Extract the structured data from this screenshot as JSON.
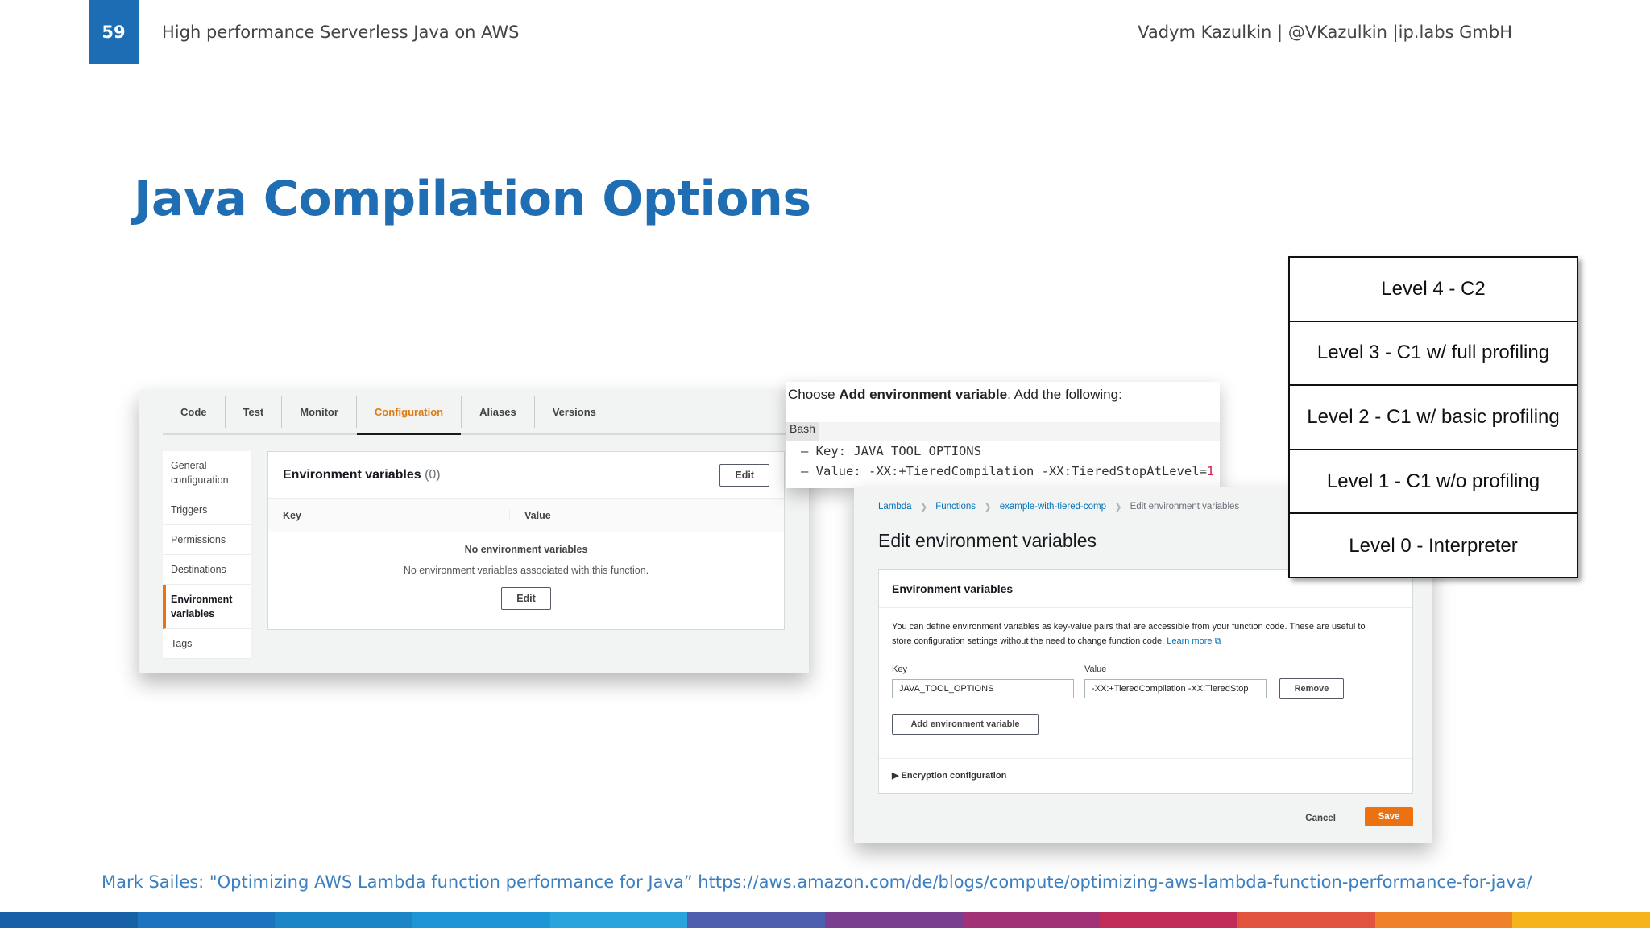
{
  "slide": {
    "page_number": "59",
    "header_title": "High performance Serverless Java on AWS",
    "author": "Vadym Kazulkin | @VKazulkin |ip.labs GmbH",
    "title": "Java Compilation Options",
    "source": "Mark Sailes: \"Optimizing AWS Lambda function performance for Java” https://aws.amazon.com/de/blogs/compute/optimizing-aws-lambda-function-performance-for-java/",
    "footer_colors": [
      "#1761a6",
      "#1b74bd",
      "#1a86c8",
      "#1e96d5",
      "#2aa4dc",
      "#4f5fb0",
      "#7a3f8f",
      "#a23277",
      "#c22c5b",
      "#e2533f",
      "#f0812b",
      "#f7b31b"
    ]
  },
  "console": {
    "tabs": [
      "Code",
      "Test",
      "Monitor",
      "Configuration",
      "Aliases",
      "Versions"
    ],
    "active_tab": "Configuration",
    "sidenav": [
      "General configuration",
      "Triggers",
      "Permissions",
      "Destinations",
      "Environment variables",
      "Tags"
    ],
    "active_nav": "Environment variables",
    "panel_title": "Environment variables",
    "panel_count": "(0)",
    "edit_label": "Edit",
    "col_key": "Key",
    "col_value": "Value",
    "empty_title": "No environment variables",
    "empty_desc": "No environment variables associated with this function.",
    "empty_edit_label": "Edit"
  },
  "instructions": {
    "prefix": "Choose ",
    "bold": "Add environment variable",
    "suffix": ". Add the following:",
    "lang": "Bash",
    "line1": "– Key: JAVA_TOOL_OPTIONS",
    "line2_text": "– Value: -XX:+TieredCompilation -XX:TieredStopAtLevel=",
    "line2_num": "1"
  },
  "edit_page": {
    "breadcrumbs": [
      "Lambda",
      "Functions",
      "example-with-tiered-comp",
      "Edit environment variables"
    ],
    "title": "Edit environment variables",
    "card_title": "Environment variables",
    "desc_line1": "You can define environment variables as key-value pairs that are accessible from your function code. These are useful to",
    "desc_line2": "store configuration settings without the need to change function code. ",
    "learn_more": "Learn more",
    "key_label": "Key",
    "value_label": "Value",
    "key_value": "JAVA_TOOL_OPTIONS",
    "value_value": "-XX:+TieredCompilation -XX:TieredStop",
    "remove_label": "Remove",
    "add_label": "Add environment variable",
    "encryption_label": "Encryption configuration",
    "cancel_label": "Cancel",
    "save_label": "Save"
  },
  "levels": [
    "Level 4 - C2",
    "Level 3 - C1 w/ full profiling",
    "Level 2 - C1 w/ basic profiling",
    "Level 1 - C1 w/o profiling",
    "Level 0 - Interpreter"
  ]
}
